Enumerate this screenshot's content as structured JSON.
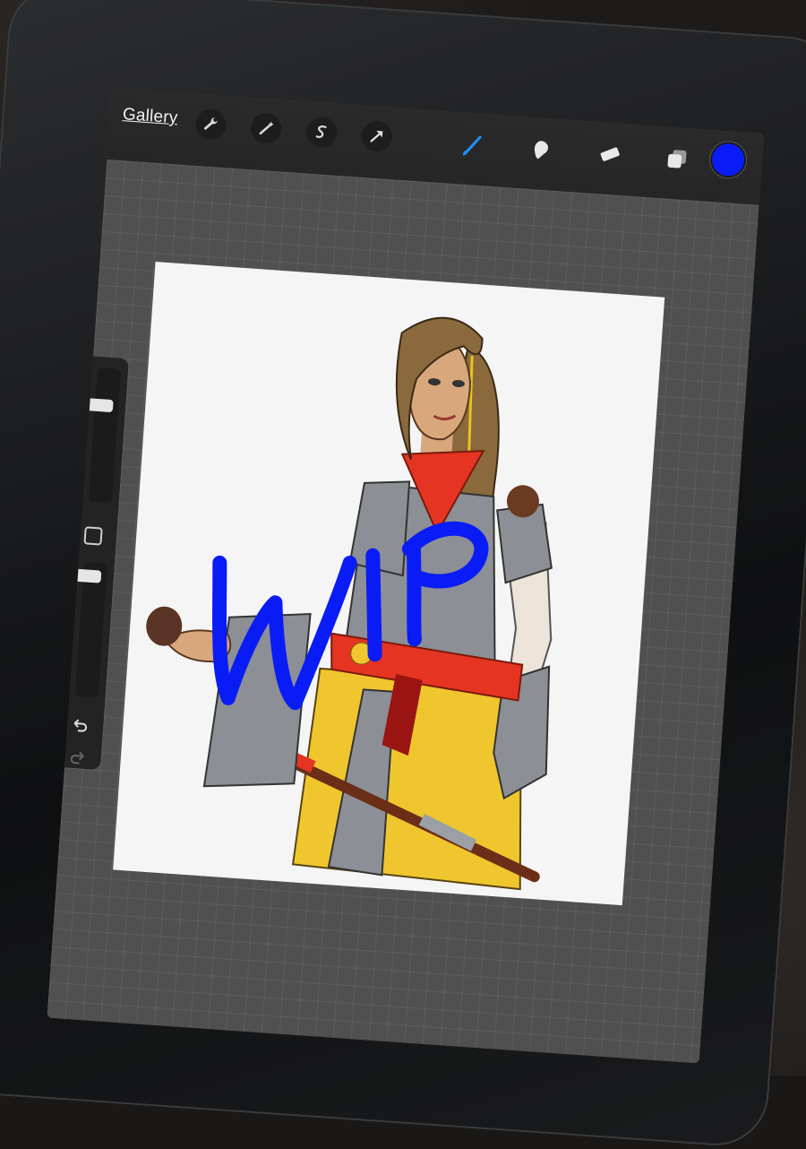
{
  "toolbar": {
    "gallery_label": "Gallery",
    "left_tools": [
      "wrench-icon",
      "magic-wand-icon",
      "selection-icon",
      "transform-arrow-icon"
    ],
    "right_tools": [
      "brush-icon",
      "smudge-icon",
      "eraser-icon",
      "layers-icon"
    ],
    "active_tool": "brush",
    "current_color": "#0a1cf5"
  },
  "sidebar": {
    "brush_size_level": 0.28,
    "opacity_level": 0.1,
    "undo": "undo-icon",
    "redo": "redo-icon"
  },
  "canvas": {
    "handwritten_text": "WIP",
    "handwritten_color": "#0a1cf5"
  },
  "colors": {
    "gray_interface": "#505050",
    "toolbar": "#262626",
    "accent_blue": "#1e90ff"
  }
}
